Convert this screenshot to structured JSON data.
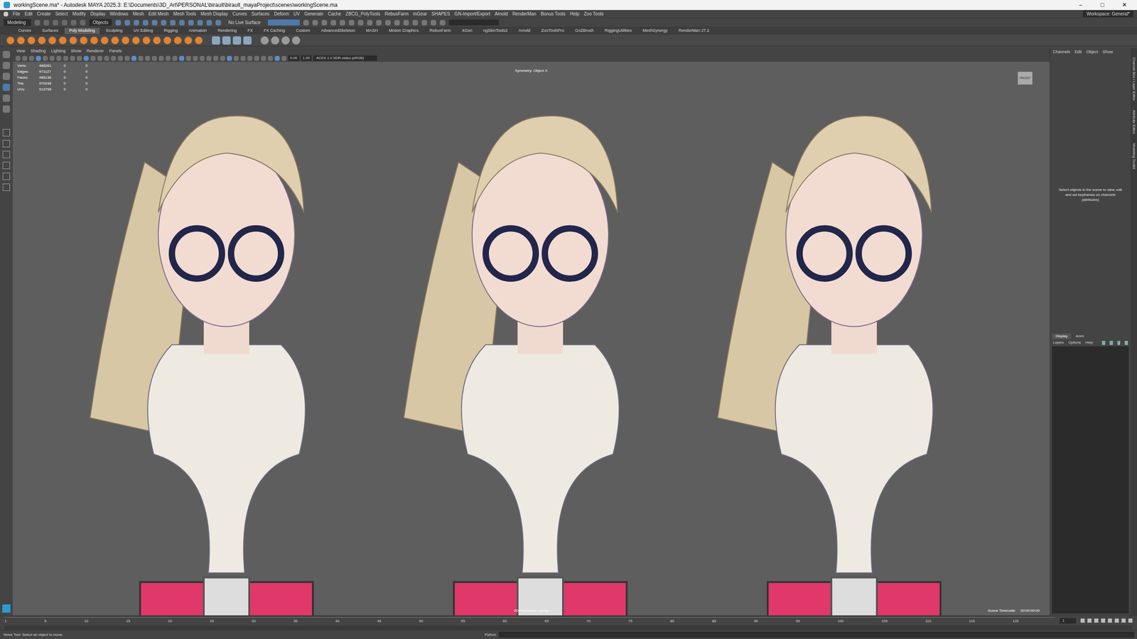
{
  "window": {
    "title": "workingScene.ma* - Autodesk MAYA 2025.3: E:\\Documents\\3D_Art\\PERSONAL\\birault\\birault_mayaProject\\scenes\\workingScene.ma",
    "controls": [
      "–",
      "□",
      "✕"
    ]
  },
  "menu": [
    "File",
    "Edit",
    "Create",
    "Select",
    "Modify",
    "Display",
    "Windows",
    "Mesh",
    "Edit Mesh",
    "Mesh Tools",
    "Mesh Display",
    "Curves",
    "Surfaces",
    "Deform",
    "UV",
    "Generate",
    "Cache",
    "ZBCG_PolyTools",
    "RebusFarm",
    "mGear",
    "SHAPES",
    "GN-Import/Export",
    "Arnold",
    "RenderMan",
    "Bonus Tools",
    "Help",
    "Zoo Tools"
  ],
  "workspace": "Workspace: General*",
  "status_line": {
    "mode": "Modeling",
    "selection_mode": "Objects",
    "live_surface": "No Live Surface"
  },
  "shelf": {
    "tabs": [
      {
        "label": "Curves",
        "selected": false
      },
      {
        "label": "Surfaces",
        "selected": false
      },
      {
        "label": "Poly Modeling",
        "selected": true
      },
      {
        "label": "Sculpting",
        "selected": false
      },
      {
        "label": "UV Editing",
        "selected": false
      },
      {
        "label": "Rigging",
        "selected": false
      },
      {
        "label": "Animation",
        "selected": false
      },
      {
        "label": "Rendering",
        "selected": false
      },
      {
        "label": "FX",
        "selected": false
      },
      {
        "label": "FX Caching",
        "selected": false
      },
      {
        "label": "Custom",
        "selected": false
      },
      {
        "label": "AdvancedSkeleton",
        "selected": false
      },
      {
        "label": "MASH",
        "selected": false
      },
      {
        "label": "Motion Graphics",
        "selected": false
      },
      {
        "label": "RebusFarm",
        "selected": false
      },
      {
        "label": "XGen",
        "selected": false
      },
      {
        "label": "ngSkinTools2",
        "selected": false
      },
      {
        "label": "Arnold",
        "selected": false
      },
      {
        "label": "ZooToolsPro",
        "selected": false
      },
      {
        "label": "GoZBrush",
        "selected": false
      },
      {
        "label": "RiggingUtilities",
        "selected": false
      },
      {
        "label": "MeshSynergy",
        "selected": false
      },
      {
        "label": "RenderMan 27.2",
        "selected": false
      }
    ]
  },
  "viewport": {
    "menu": [
      "View",
      "Shading",
      "Lighting",
      "Show",
      "Renderer",
      "Panels"
    ],
    "toolbar_fields": [
      "0.00",
      "1.00"
    ],
    "color_space": "ACES 1.0 SDR-video (sRGB)",
    "hud": {
      "stats": [
        {
          "label": "Verts:",
          "values": [
            "486261",
            "0",
            "0"
          ]
        },
        {
          "label": "Edges:",
          "values": [
            "971127",
            "0",
            "0"
          ]
        },
        {
          "label": "Faces:",
          "values": [
            "485136",
            "0",
            "0"
          ]
        },
        {
          "label": "Tris:",
          "values": [
            "970248",
            "0",
            "0"
          ]
        },
        {
          "label": "UVs:",
          "values": [
            "513798",
            "0",
            "0"
          ]
        }
      ],
      "symmetry": "Symmetry: Object X",
      "camera_mode": "2D Pan/Zoom : persp",
      "timecode_label": "Scene Timecode:",
      "timecode_value": "00:00:00:00"
    },
    "view_cube": "FRONT"
  },
  "channel_box": {
    "tabs": [
      "Channels",
      "Edit",
      "Object",
      "Show"
    ],
    "message": "Select objects in the scene to view, edit and set keyframes on channels (attributes)"
  },
  "layer_editor": {
    "tabs": [
      {
        "label": "Display",
        "selected": true
      },
      {
        "label": "Anim",
        "selected": false
      }
    ],
    "menu": [
      "Layers",
      "Options",
      "Help"
    ]
  },
  "side_tabs": [
    "Channel Box / Layer Editor",
    "Attribute Editor",
    "Modeling Toolkit"
  ],
  "timeline": {
    "ticks": [
      "1",
      "5",
      "10",
      "15",
      "20",
      "25",
      "30",
      "35",
      "40",
      "45",
      "50",
      "55",
      "60",
      "65",
      "70",
      "75",
      "80",
      "85",
      "90",
      "95",
      "100",
      "105",
      "110",
      "115",
      "120"
    ],
    "current_frame": "1"
  },
  "command_line": {
    "language": "Python"
  },
  "help_line": "Move Tool: Select an object to move."
}
